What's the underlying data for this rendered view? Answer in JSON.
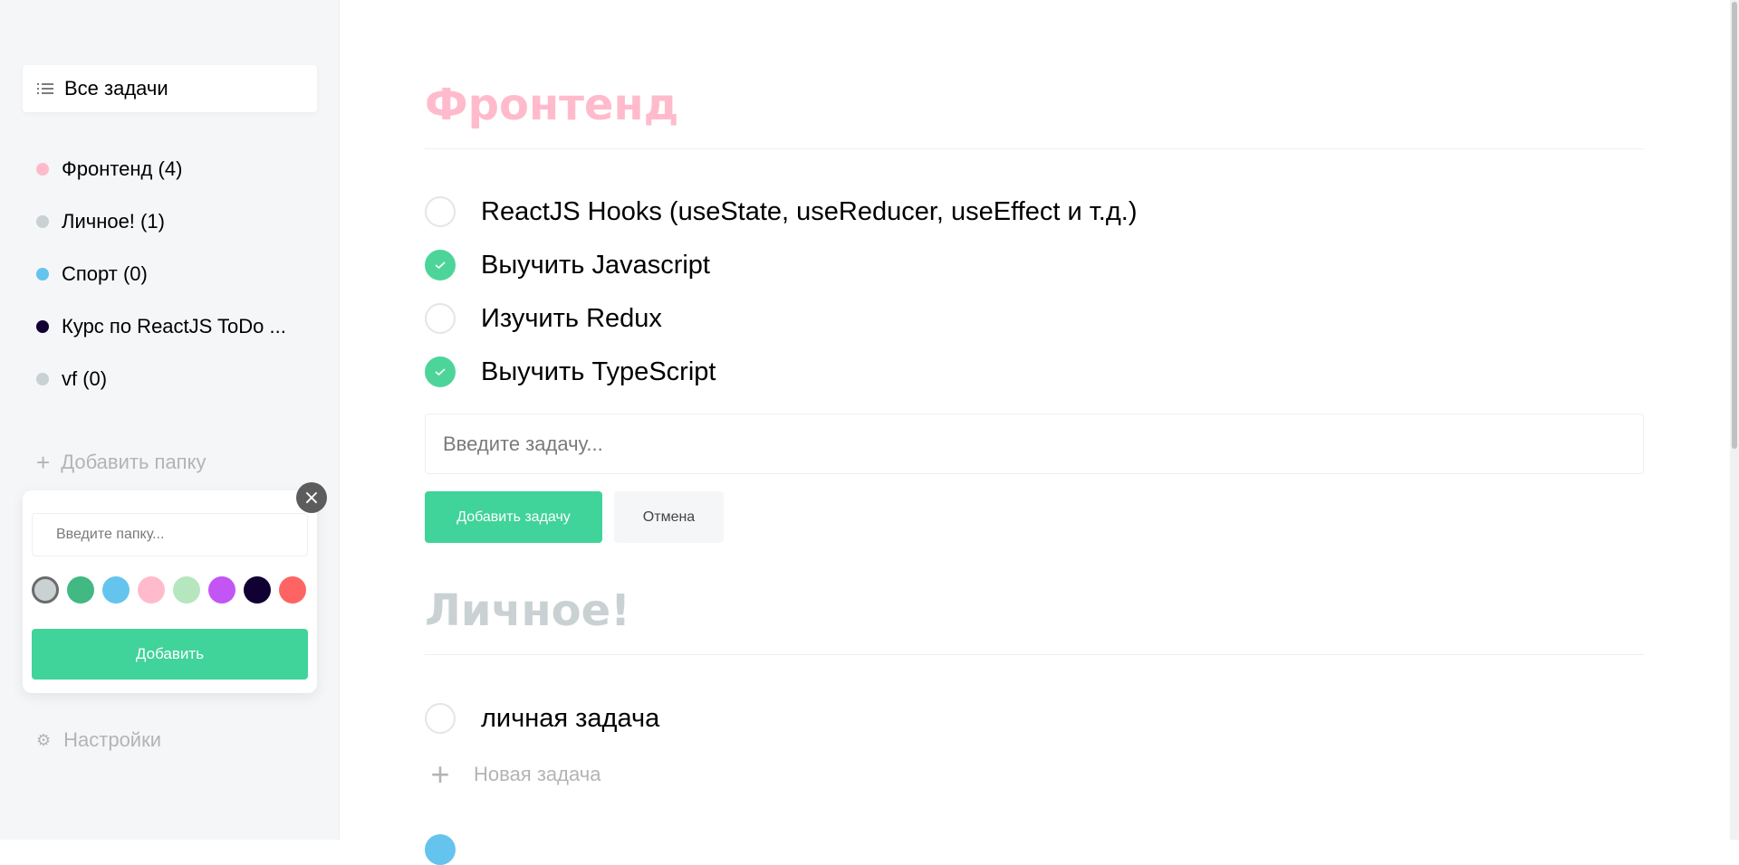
{
  "sidebar": {
    "all_tasks_label": "Все задачи",
    "folders": [
      {
        "label": "Фронтенд (4)",
        "color": "#ffbbcc"
      },
      {
        "label": "Личное! (1)",
        "color": "#c9d1d3"
      },
      {
        "label": "Спорт (0)",
        "color": "#64c4ed"
      },
      {
        "label": "Курс по ReactJS ToDo ...",
        "color": "#110133"
      },
      {
        "label": "vf (0)",
        "color": "#c9d1d3"
      }
    ],
    "add_folder_label": "Добавить папку",
    "settings_label": "Настройки"
  },
  "popup": {
    "input_placeholder": "Введите папку...",
    "colors": [
      "#c9d1d3",
      "#42b883",
      "#64c4ed",
      "#ffbbcc",
      "#b6e6bd",
      "#c355f5",
      "#110133",
      "#ff6464"
    ],
    "selected_color": "#c9d1d3",
    "add_button_label": "Добавить",
    "close_icon": "×"
  },
  "lists": [
    {
      "title": "Фронтенд",
      "color": "#ffbbcc",
      "tasks": [
        {
          "text": "ReactJS Hooks (useState, useReducer, useEffect и т.д.)",
          "completed": false
        },
        {
          "text": "Выучить Javascript",
          "completed": true
        },
        {
          "text": "Изучить Redux",
          "completed": false
        },
        {
          "text": "Выучить TypeScript",
          "completed": true
        }
      ],
      "task_input_placeholder": "Введите задачу...",
      "add_task_label": "Добавить задачу",
      "cancel_label": "Отмена"
    },
    {
      "title": "Личное!",
      "color": "#c9d1d3",
      "tasks": [
        {
          "text": "личная задача",
          "completed": false
        }
      ],
      "new_task_label": "Новая задача"
    }
  ]
}
